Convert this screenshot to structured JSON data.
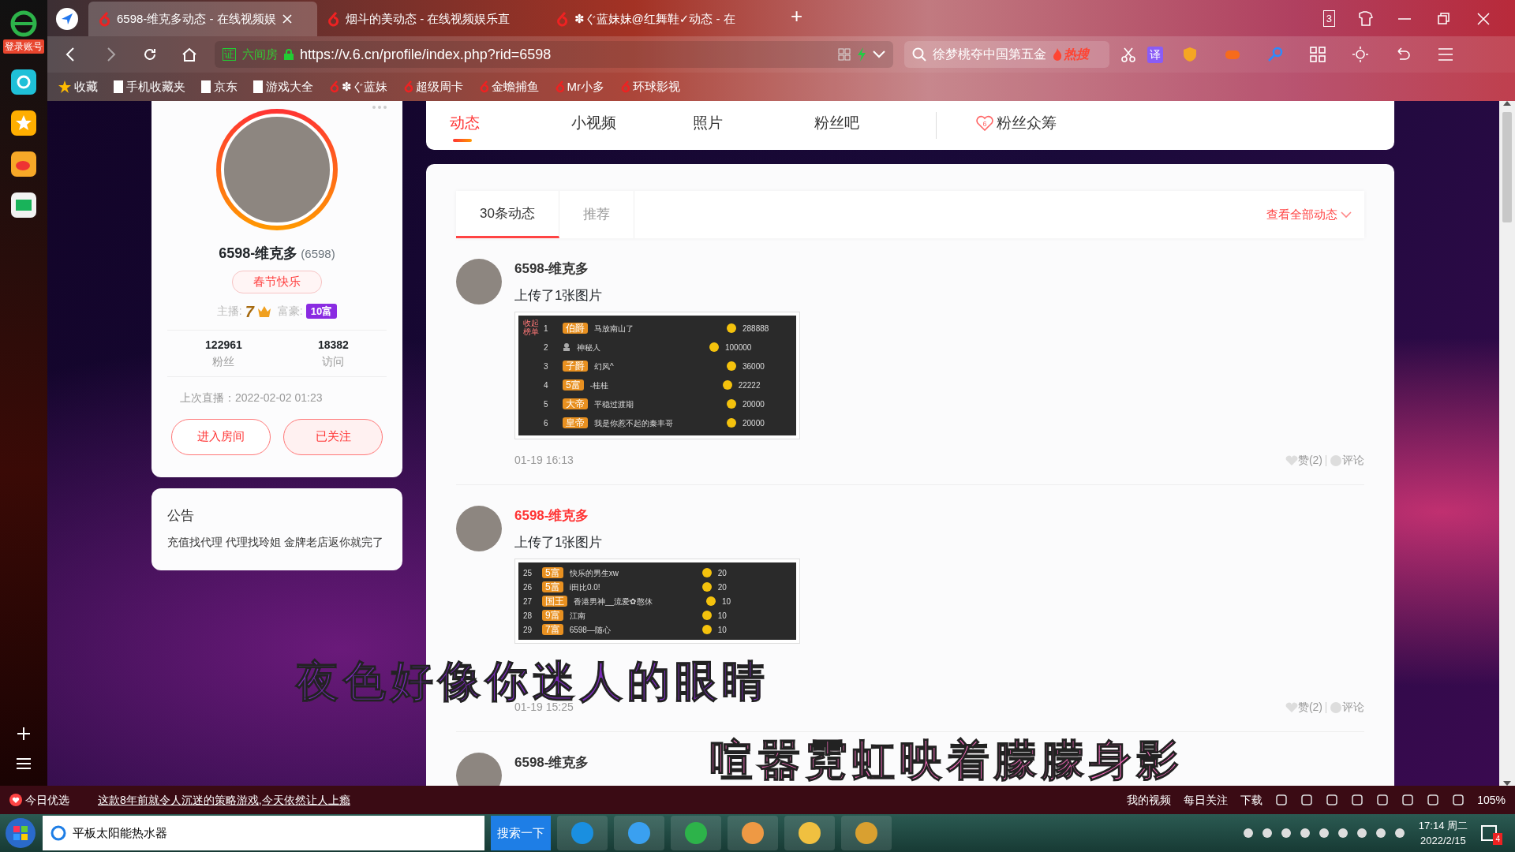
{
  "dock": {
    "login": "登录账号"
  },
  "browser": {
    "tabs": [
      {
        "title": "6598-维克多动态 - 在线视频娱",
        "selected": true
      },
      {
        "title": "烟斗的美动态 - 在线视频娱乐直",
        "selected": false
      },
      {
        "title": "✽ぐ蓝妹妹@红舞鞋✓动态 - 在",
        "selected": false
      }
    ],
    "new_tab": "+",
    "tab_count": "3",
    "address": {
      "site_badge": "六间房",
      "cert": "证",
      "url": "https://v.6.cn/profile/index.php?rid=6598"
    },
    "search": {
      "value": "徐梦桃夺中国第五金",
      "hot": "热搜"
    },
    "translate": "译",
    "bookmarks": [
      "收藏",
      "手机收藏夹",
      "京东",
      "游戏大全",
      "✽ぐ蓝妹",
      "超级周卡",
      "金蟾捕鱼",
      "Mr小多",
      "环球影视"
    ]
  },
  "profile": {
    "name": "6598-维克多",
    "rid": "(6598)",
    "tag": "春节快乐",
    "anchor_label": "主播:",
    "anchor_level": "7",
    "rich_label": "富豪:",
    "rich_badge": "10富",
    "stats": [
      {
        "value": "122961",
        "label": "粉丝"
      },
      {
        "value": "18382",
        "label": "访问"
      }
    ],
    "last_live": "上次直播：2022-02-02 01:23",
    "buttons": [
      {
        "label": "进入房间",
        "kind": "outline"
      },
      {
        "label": "已关注",
        "kind": "filled"
      }
    ]
  },
  "notice": {
    "title": "公告",
    "text": "充值找代理 代理找玲姐 金牌老店返你就完了"
  },
  "nav_tabs": [
    {
      "label": "动态",
      "selected": true,
      "kind": "text"
    },
    {
      "label": "小视频",
      "selected": false,
      "kind": "text"
    },
    {
      "label": "照片",
      "selected": false,
      "kind": "text"
    },
    {
      "label": "粉丝吧",
      "selected": false,
      "kind": "text"
    },
    {
      "label": "粉丝众筹",
      "selected": false,
      "kind": "heart",
      "icon_text": "6"
    }
  ],
  "feed": {
    "tabs": [
      {
        "label": "30条动态",
        "selected": true
      },
      {
        "label": "推荐",
        "selected": false
      }
    ],
    "view_all": "查看全部动态",
    "posts": [
      {
        "author": "6598-维克多",
        "highlighted": false,
        "text": "上传了1张图片",
        "image": {
          "side": "收起榜单",
          "rows": [
            {
              "rank": "1",
              "badge": "伯爵",
              "name": "马放南山了",
              "coins": "288888"
            },
            {
              "rank": "2",
              "badge": "",
              "name": "神秘人",
              "coins": "100000"
            },
            {
              "rank": "3",
              "badge": "子爵",
              "name": "幻风^",
              "coins": "36000"
            },
            {
              "rank": "4",
              "badge": "5富",
              "name": "-桂桂",
              "coins": "22222"
            },
            {
              "rank": "5",
              "badge": "大帝",
              "name": "平稳过渡期",
              "coins": "20000"
            },
            {
              "rank": "6",
              "badge": "皇帝",
              "name": "我是你惹不起的秦丰哥",
              "coins": "20000"
            }
          ]
        },
        "time": "01-19 16:13",
        "likes": "赞(2)",
        "comment": "评论"
      },
      {
        "author": "6598-维克多",
        "highlighted": true,
        "text": "上传了1张图片",
        "image": {
          "rows": [
            {
              "rank": "25",
              "badge": "5富",
              "name": "快乐的男生xw",
              "coins": "20"
            },
            {
              "rank": "26",
              "badge": "5富",
              "name": "i田比0.0!",
              "coins": "20"
            },
            {
              "rank": "27",
              "badge": "国王",
              "name": "香港男神__流爱✿憨休",
              "coins": "10"
            },
            {
              "rank": "28",
              "badge": "9富",
              "name": "江南",
              "coins": "10"
            },
            {
              "rank": "29",
              "badge": "7富",
              "name": "6598—随心",
              "coins": "10"
            }
          ]
        },
        "time": "01-19 15:25",
        "likes": "赞(2)",
        "comment": "评论"
      },
      {
        "author": "6598-维克多",
        "highlighted": false
      }
    ]
  },
  "lyrics": [
    "夜色好像你迷人的眼睛",
    "喧嚣霓虹映着朦朦身影"
  ],
  "status_bar": {
    "left": "今日优选",
    "news": "这款8年前就令人沉迷的策略游戏,今天依然让人上瘾",
    "right": [
      "我的视频",
      "每日关注",
      "下载"
    ],
    "zoom": "105%"
  },
  "taskbar": {
    "search": "平板太阳能热水器",
    "search_button": "搜索一下",
    "time": "17:14 周二",
    "date": "2022/2/15",
    "badge": "4"
  }
}
